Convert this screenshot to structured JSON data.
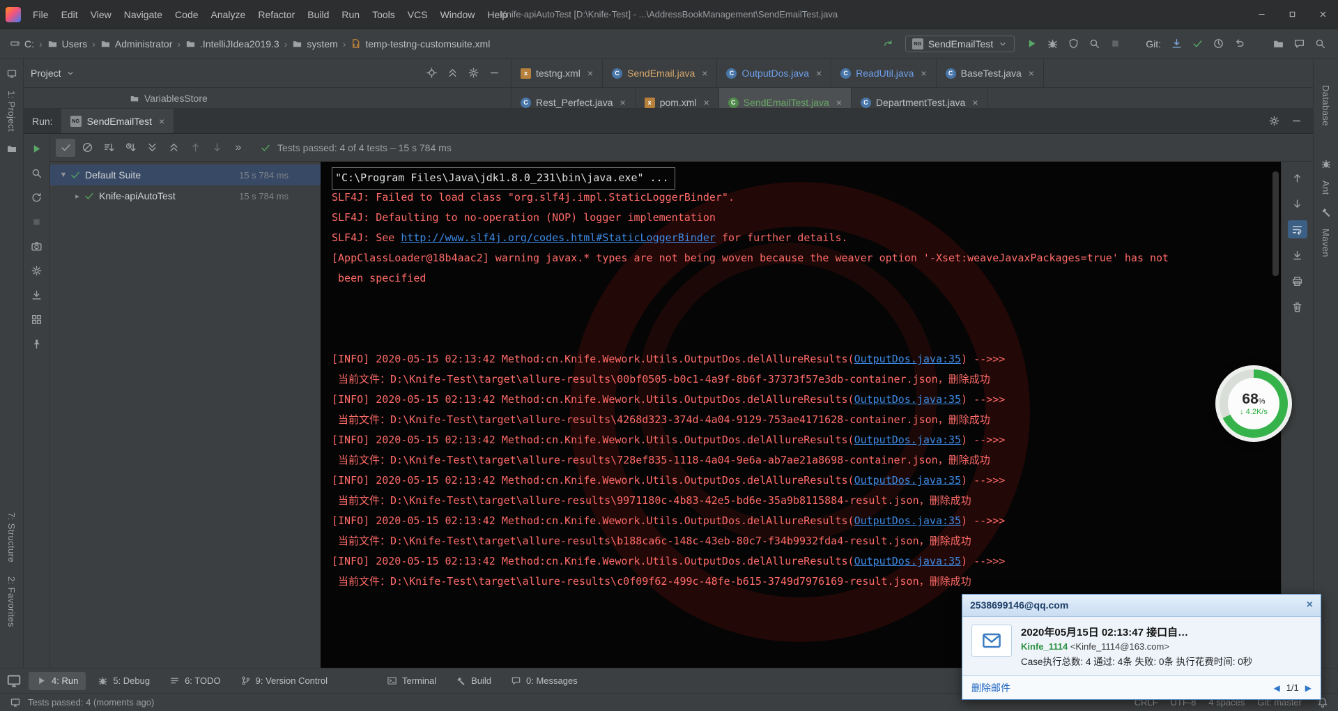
{
  "colors": {
    "accent_green": "#499c54",
    "error_red": "#ff6b68",
    "link_blue": "#3d8ae5",
    "progress_green": "#35b24a"
  },
  "icons_legend": {
    "testng_badge": "NG"
  },
  "title_bar": {
    "menus": [
      "File",
      "Edit",
      "View",
      "Navigate",
      "Code",
      "Analyze",
      "Refactor",
      "Build",
      "Run",
      "Tools",
      "VCS",
      "Window",
      "Help"
    ],
    "title": "Knife-apiAutoTest [D:\\Knife-Test] - ...\\AddressBookManagement\\SendEmailTest.java",
    "window_buttons": [
      {
        "name": "minimize-window-button",
        "icon": "minimize"
      },
      {
        "name": "maximize-window-button",
        "icon": "maxim"
      },
      {
        "name": "close-window-button",
        "icon": "close"
      }
    ]
  },
  "navbar": {
    "breadcrumbs": [
      {
        "label": "C:",
        "icon": "drive"
      },
      {
        "label": "Users",
        "icon": "folder"
      },
      {
        "label": "Administrator",
        "icon": "folder"
      },
      {
        "label": ".IntelliJIdea2019.3",
        "icon": "folder"
      },
      {
        "label": "system",
        "icon": "folder"
      },
      {
        "label": "temp-testng-customsuite.xml",
        "icon": "xmlfile"
      }
    ],
    "run_config": "SendEmailTest",
    "run_icons": [
      {
        "name": "run-button",
        "icon": "play",
        "color": "#59a869"
      },
      {
        "name": "debug-button",
        "icon": "bug",
        "color": "#9fa3a6"
      },
      {
        "name": "coverage-button",
        "icon": "shield",
        "color": "#9fa3a6"
      },
      {
        "name": "profiler-button",
        "icon": "search",
        "color": "#9fa3a6"
      },
      {
        "name": "stop-button",
        "icon": "stop",
        "color": "#616467"
      }
    ],
    "git_label": "Git:",
    "git_icons": [
      {
        "name": "vcs-update-button",
        "icon": "import",
        "color": "#7ba7d7"
      },
      {
        "name": "vcs-commit-button",
        "icon": "checkmark",
        "color": "#59a869"
      },
      {
        "name": "vcs-history-button",
        "icon": "clock",
        "color": "#9fa3a6"
      },
      {
        "name": "vcs-rollback-button",
        "icon": "undo",
        "color": "#9fa3a6"
      }
    ],
    "far_icons": [
      {
        "name": "project-structure-button",
        "icon": "folder",
        "color": "#9fa3a6"
      },
      {
        "name": "layout-button",
        "icon": "messages",
        "color": "#9fa3a6"
      },
      {
        "name": "search-everywhere-button",
        "icon": "search",
        "color": "#9fa3a6"
      }
    ]
  },
  "project_panel": {
    "title": "Project",
    "partial_item": "VariablesStore",
    "header_icons": [
      {
        "name": "locate-file-button",
        "icon": "crosshair"
      },
      {
        "name": "collapse-all-button",
        "icon": "collapse"
      },
      {
        "name": "project-options-button",
        "icon": "gear"
      },
      {
        "name": "hide-project-button",
        "icon": "minimize"
      }
    ]
  },
  "editor_tabs_row1": [
    {
      "label": "testng.xml",
      "icon": "xml",
      "color": "#bcbec0"
    },
    {
      "label": "SendEmail.java",
      "icon": "class",
      "color": "#d2a56b"
    },
    {
      "label": "OutputDos.java",
      "icon": "class",
      "color": "#6d9ee8"
    },
    {
      "label": "ReadUtil.java",
      "icon": "class",
      "color": "#6d9ee8"
    },
    {
      "label": "BaseTest.java",
      "icon": "class",
      "color": "#bcbec0"
    }
  ],
  "editor_tabs_row2": [
    {
      "label": "Rest_Perfect.java",
      "icon": "class",
      "color": "#bcbec0"
    },
    {
      "label": "pom.xml",
      "icon": "xml",
      "color": "#bcbec0"
    },
    {
      "label": "SendEmailTest.java",
      "icon": "testclass",
      "color": "#67a564",
      "selected": true
    },
    {
      "label": "DepartmentTest.java",
      "icon": "class",
      "color": "#bcbec0"
    }
  ],
  "run_panel": {
    "label": "Run:",
    "tab": "SendEmailTest",
    "tab_icon": "NG",
    "status": "Tests passed: 4 of 4 tests – 15 s 784 ms",
    "header_icons": [
      {
        "name": "run-settings-button",
        "icon": "gear"
      },
      {
        "name": "hide-run-panel-button",
        "icon": "minimize"
      }
    ],
    "vertical_toolbar": [
      {
        "name": "rerun-button",
        "icon": "play",
        "color": "#59a869"
      },
      {
        "name": "filter-tests-button",
        "icon": "search",
        "color": "#9fa3a6"
      },
      {
        "name": "rerun-failed-button",
        "icon": "refresh",
        "color": "#9fa3a6"
      },
      {
        "name": "stop-process-button",
        "icon": "stop",
        "color": "#5a5d5f"
      },
      {
        "name": "thread-dump-button",
        "icon": "camera",
        "color": "#9fa3a6"
      },
      {
        "name": "test-settings-button",
        "icon": "gear",
        "color": "#9fa3a6"
      },
      {
        "name": "import-test-results-button",
        "icon": "import",
        "color": "#9fa3a6"
      },
      {
        "name": "test-history-button",
        "icon": "grid",
        "color": "#9fa3a6"
      },
      {
        "name": "pin-tab-button",
        "icon": "pin",
        "color": "#9fa3a6"
      }
    ],
    "toolbar": [
      {
        "name": "show-passed-toggle",
        "icon": "checkmark",
        "pressed": true
      },
      {
        "name": "show-ignored-toggle",
        "icon": "circleslash"
      },
      {
        "name": "sort-alphabetically-toggle",
        "icon": "sortAZ"
      },
      {
        "name": "sort-by-duration-toggle",
        "icon": "sortTime"
      },
      {
        "name": "expand-all-button",
        "icon": "expand"
      },
      {
        "name": "collapse-all-button",
        "icon": "collapse"
      },
      {
        "name": "previous-failed-test-button",
        "icon": "uparrow",
        "color": "#6b6e70"
      },
      {
        "name": "next-failed-test-button",
        "icon": "downarrow",
        "color": "#6b6e70"
      },
      {
        "name": "more-options-button",
        "glyph": "»"
      }
    ],
    "tree": [
      {
        "arrow": "▼",
        "name": "Default Suite",
        "time": "15 s 784 ms",
        "selected": true,
        "indent": 0
      },
      {
        "arrow": "▸",
        "name": "Knife-apiAutoTest",
        "time": "15 s 784 ms",
        "selected": false,
        "indent": 1
      }
    ]
  },
  "console": {
    "toolbar": [
      {
        "name": "prev-stacktrace-button",
        "icon": "uparrow"
      },
      {
        "name": "next-stacktrace-button",
        "icon": "downarrow"
      },
      {
        "name": "soft-wrap-toggle",
        "icon": "wrap",
        "pressed": true
      },
      {
        "name": "scroll-to-end-button",
        "icon": "scrollend"
      },
      {
        "name": "print-console-button",
        "icon": "printer"
      },
      {
        "name": "clear-console-button",
        "icon": "trash"
      }
    ],
    "lines": [
      {
        "box": true,
        "segs": [
          {
            "s": "cmd",
            "t": "\"C:\\Program Files\\Java\\jdk1.8.0_231\\bin\\java.exe\" ..."
          }
        ]
      },
      {
        "segs": [
          {
            "s": "err",
            "t": "SLF4J: Failed to load class \"org.slf4j.impl.StaticLoggerBinder\"."
          }
        ]
      },
      {
        "segs": [
          {
            "s": "err",
            "t": "SLF4J: Defaulting to no-operation (NOP) logger implementation"
          }
        ]
      },
      {
        "segs": [
          {
            "s": "err",
            "t": "SLF4J: See "
          },
          {
            "s": "link",
            "t": "http://www.slf4j.org/codes.html#StaticLoggerBinder"
          },
          {
            "s": "err",
            "t": " for further details."
          }
        ]
      },
      {
        "segs": [
          {
            "s": "err",
            "t": "[AppClassLoader@18b4aac2] warning javax.* types are not being woven because the weaver option '-Xset:weaveJavaxPackages=true' has not"
          }
        ]
      },
      {
        "segs": [
          {
            "s": "err",
            "t": " been specified"
          }
        ]
      },
      {
        "segs": []
      },
      {
        "segs": []
      },
      {
        "segs": []
      },
      {
        "segs": [
          {
            "s": "err",
            "t": "[INFO] 2020-05-15 02:13:42 Method:cn.Knife.Wework.Utils.OutputDos.delAllureResults("
          },
          {
            "s": "link",
            "t": "OutputDos.java:35"
          },
          {
            "s": "err",
            "t": ") -->>>"
          }
        ]
      },
      {
        "segs": [
          {
            "s": "err",
            "t": " 当前文件：D:\\Knife-Test\\target\\allure-results\\00bf0505-b0c1-4a9f-8b6f-37373f57e3db-container.json，删除成功"
          }
        ]
      },
      {
        "segs": [
          {
            "s": "err",
            "t": "[INFO] 2020-05-15 02:13:42 Method:cn.Knife.Wework.Utils.OutputDos.delAllureResults("
          },
          {
            "s": "link",
            "t": "OutputDos.java:35"
          },
          {
            "s": "err",
            "t": ") -->>>"
          }
        ]
      },
      {
        "segs": [
          {
            "s": "err",
            "t": " 当前文件：D:\\Knife-Test\\target\\allure-results\\4268d323-374d-4a04-9129-753ae4171628-container.json，删除成功"
          }
        ]
      },
      {
        "segs": [
          {
            "s": "err",
            "t": "[INFO] 2020-05-15 02:13:42 Method:cn.Knife.Wework.Utils.OutputDos.delAllureResults("
          },
          {
            "s": "link",
            "t": "OutputDos.java:35"
          },
          {
            "s": "err",
            "t": ") -->>>"
          }
        ]
      },
      {
        "segs": [
          {
            "s": "err",
            "t": " 当前文件：D:\\Knife-Test\\target\\allure-results\\728ef835-1118-4a04-9e6a-ab7ae21a8698-container.json，删除成功"
          }
        ]
      },
      {
        "segs": [
          {
            "s": "err",
            "t": "[INFO] 2020-05-15 02:13:42 Method:cn.Knife.Wework.Utils.OutputDos.delAllureResults("
          },
          {
            "s": "link",
            "t": "OutputDos.java:35"
          },
          {
            "s": "err",
            "t": ") -->>>"
          }
        ]
      },
      {
        "segs": [
          {
            "s": "err",
            "t": " 当前文件：D:\\Knife-Test\\target\\allure-results\\9971180c-4b83-42e5-bd6e-35a9b8115884-result.json，删除成功"
          }
        ]
      },
      {
        "segs": [
          {
            "s": "err",
            "t": "[INFO] 2020-05-15 02:13:42 Method:cn.Knife.Wework.Utils.OutputDos.delAllureResults("
          },
          {
            "s": "link",
            "t": "OutputDos.java:35"
          },
          {
            "s": "err",
            "t": ") -->>>"
          }
        ]
      },
      {
        "segs": [
          {
            "s": "err",
            "t": " 当前文件：D:\\Knife-Test\\target\\allure-results\\b188ca6c-148c-43eb-80c7-f34b9932fda4-result.json，删除成功"
          }
        ]
      },
      {
        "segs": [
          {
            "s": "err",
            "t": "[INFO] 2020-05-15 02:13:42 Method:cn.Knife.Wework.Utils.OutputDos.delAllureResults("
          },
          {
            "s": "link",
            "t": "OutputDos.java:35"
          },
          {
            "s": "err",
            "t": ") -->>>"
          }
        ]
      },
      {
        "segs": [
          {
            "s": "err",
            "t": " 当前文件：D:\\Knife-Test\\target\\allure-results\\c0f09f62-499c-48fe-b615-3749d7976169-result.json，删除成功"
          }
        ]
      }
    ]
  },
  "speed_overlay": {
    "percent": "68",
    "unit": "%",
    "speed": "↓ 4.2K/s"
  },
  "popup": {
    "header": "2538699146@qq.com",
    "title": "2020年05月15日 02:13:47 接口自…",
    "sender_name": "Kinfe_1114",
    "sender_email": "<Kinfe_1114@163.com>",
    "body": "Case执行总数: 4 通过: 4条 失败: 0条 执行花费时间: 0秒",
    "delete_label": "删除邮件",
    "page": "1/1"
  },
  "bottom_bar": {
    "tabs": [
      {
        "label": "4: Run",
        "icon": "play",
        "active": true
      },
      {
        "label": "5: Debug",
        "icon": "bug",
        "active": false
      },
      {
        "label": "6: TODO",
        "icon": "todo",
        "active": false
      },
      {
        "label": "9: Version Control",
        "icon": "branch",
        "active": false
      },
      {
        "label": "Terminal",
        "icon": "terminal",
        "active": false,
        "ml": true
      },
      {
        "label": "Build",
        "icon": "hammer",
        "active": false
      },
      {
        "label": "0: Messages",
        "icon": "messages",
        "active": false
      }
    ]
  },
  "status_bar": {
    "left": "Tests passed: 4 (moments ago)",
    "right": [
      "CRLF",
      "UTF-8",
      "4 spaces",
      "Git: master"
    ]
  },
  "left_stripe": {
    "items": [
      "1: Project",
      "7: Structure",
      "2: Favorites"
    ]
  },
  "right_stripe": {
    "items": [
      "Database",
      "Ant",
      "Maven"
    ]
  }
}
